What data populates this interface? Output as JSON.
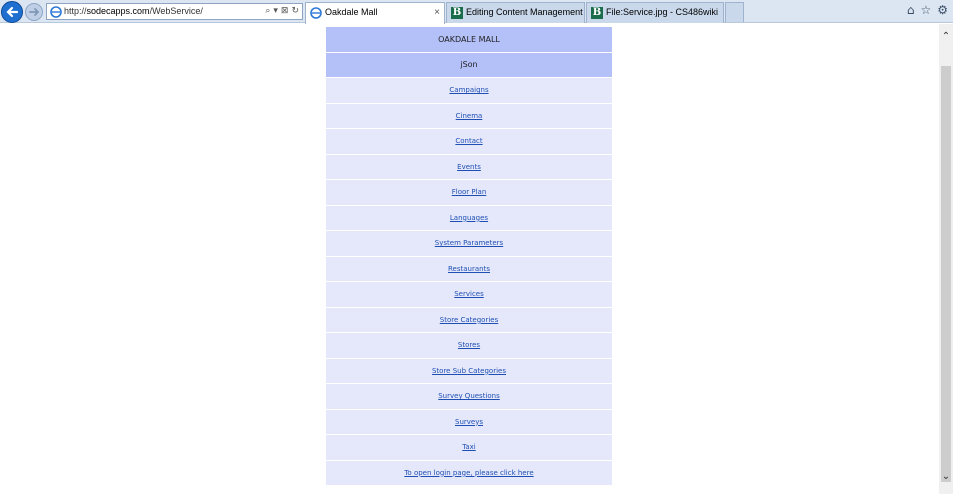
{
  "browser": {
    "url_prefix": "http://",
    "url_host": "sodecapps.com",
    "url_path": "/WebService/",
    "address_tools": [
      "⌕",
      "▾",
      "⊠",
      "↻"
    ],
    "tabs": [
      {
        "label": "Oakdale Mall",
        "close": "×"
      },
      {
        "label": "Editing Content Management ..."
      },
      {
        "label": "File:Service.jpg - CS486wiki"
      }
    ],
    "tab_favicon_letter": "B",
    "right_icons": [
      "⌂",
      "☆",
      "⚙"
    ]
  },
  "page": {
    "title": "OAKDALE MALL",
    "subtitle": "jSon",
    "links": [
      "Campaigns",
      "Cinema",
      "Contact",
      "Events",
      "Floor Plan",
      "Languages",
      "System Parameters",
      "Restaurants",
      "Services",
      "Store Categories",
      "Stores",
      "Store Sub Categories",
      "Survey Questions",
      "Surveys",
      "Taxi",
      "To open login page, please click here"
    ]
  },
  "colors": {
    "header_row": "#b4c0f8",
    "link_row": "#e4e8fa",
    "link_text": "#1f4fb5"
  }
}
